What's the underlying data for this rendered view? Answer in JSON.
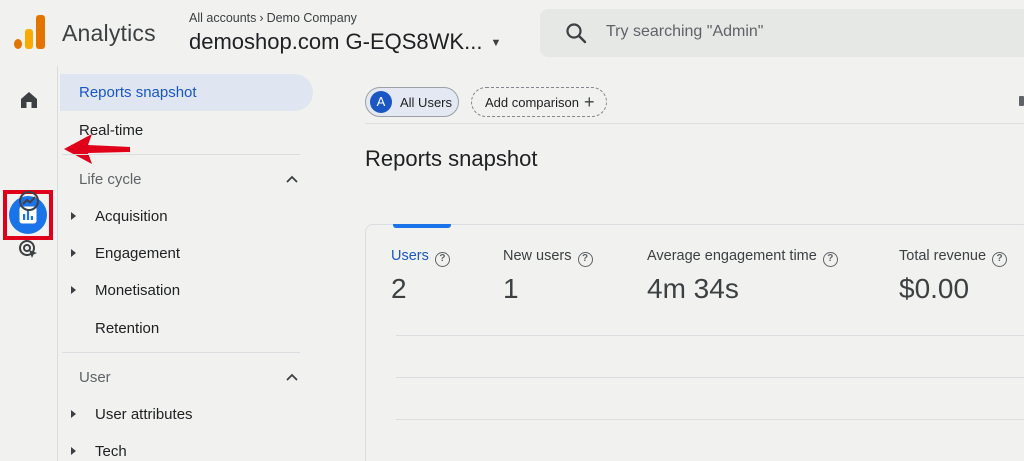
{
  "header": {
    "app_title": "Analytics",
    "breadcrumb": {
      "account": "All accounts",
      "company": "Demo Company"
    },
    "property_name": "demoshop.com G-EQS8WK...",
    "search_placeholder": "Try searching \"Admin\""
  },
  "rail": {
    "icons": [
      "home-icon",
      "reports-icon",
      "explore-icon",
      "advertising-icon"
    ],
    "active": "reports-icon",
    "highlight_color": "#e1001a"
  },
  "nav": {
    "active_item": "Reports snapshot",
    "realtime": "Real-time",
    "sections": [
      {
        "title": "Life cycle",
        "items": [
          {
            "label": "Acquisition",
            "expandable": true
          },
          {
            "label": "Engagement",
            "expandable": true
          },
          {
            "label": "Monetisation",
            "expandable": true
          },
          {
            "label": "Retention",
            "expandable": false
          }
        ]
      },
      {
        "title": "User",
        "items": [
          {
            "label": "User attributes",
            "expandable": true
          },
          {
            "label": "Tech",
            "expandable": true
          }
        ]
      }
    ]
  },
  "main": {
    "segment_chip": {
      "avatar": "A",
      "label": "All Users"
    },
    "compare_chip": {
      "label": "Add comparison"
    },
    "page_title": "Reports snapshot",
    "metrics": [
      {
        "label": "Users",
        "value": "2",
        "selected": true
      },
      {
        "label": "New users",
        "value": "1",
        "selected": false
      },
      {
        "label": "Average engagement time",
        "value": "4m 34s",
        "selected": false
      },
      {
        "label": "Total revenue",
        "value": "$0.00",
        "selected": false
      }
    ]
  },
  "colors": {
    "accent": "#1a73e8",
    "active_nav_bg": "#dfe6f1",
    "background": "#f1f2ef"
  }
}
